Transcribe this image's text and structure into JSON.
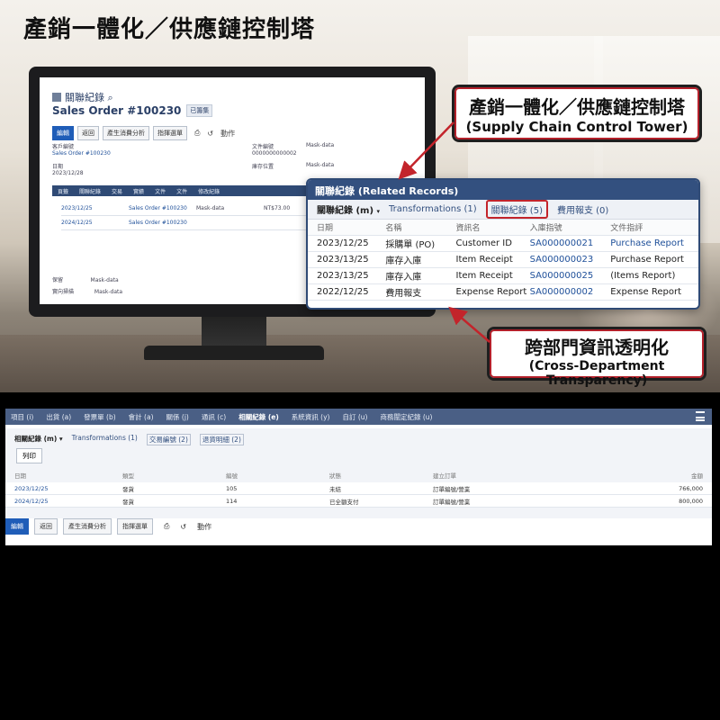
{
  "banner_title": "產銷一體化／供應鏈控制塔",
  "callout_top": {
    "zh": "產銷一體化／供應鏈控制塔",
    "en": "(Supply Chain Control Tower)"
  },
  "callout_bottom": {
    "zh": "跨部門資訊透明化",
    "en": "(Cross-Department Transparency)"
  },
  "monitor_screen": {
    "header": "關聯紀錄",
    "title": "Sales Order #100230",
    "status_badge": "已籌集",
    "toolbar": [
      "編輯",
      "返回",
      "產生消費分析",
      "指揮選單",
      "動作"
    ],
    "fields": {
      "label1": "客戶編號",
      "value1": "Sales Order #100230",
      "label2": "日期",
      "value2": "2023/12/28",
      "label3": "文件編號",
      "value3": "0000000000002",
      "label4": "庫存位置",
      "value4": "Mask-data",
      "label5": "Mask-data"
    },
    "tabs": [
      "頁籤",
      "關聯紀錄",
      "交易",
      "實績",
      "文件",
      "文件",
      "修改紀錄"
    ],
    "rows": [
      {
        "date": "2023/12/25",
        "ref": "Sales Order #100230",
        "sub": "Mask-data",
        "amount": "NT$73.00"
      },
      {
        "date": "2024/12/25",
        "ref": "Sales Order #100230",
        "sub": "",
        "amount": ""
      }
    ],
    "footer": {
      "l1": "保留",
      "v1": "Mask-data",
      "l2": "實向掃描",
      "v2": "Mask-data"
    }
  },
  "related_panel": {
    "title": "關聯紀錄 (Related Records)",
    "tabs": [
      "關聯紀錄 (m)",
      "Transformations (1)",
      "關聯紀錄 (5)",
      "費用報支 (0)"
    ],
    "columns": [
      "日期",
      "名稱",
      "資訊名",
      "入庫指號",
      "文件指評"
    ],
    "rows": [
      [
        "2023/12/25",
        "採購單 (PO)",
        "Customer ID",
        "SA000000021",
        "Purchase Report"
      ],
      [
        "2023/13/25",
        "庫存入庫",
        "Item Receipt",
        "SA000000023",
        "Purchase Report"
      ],
      [
        "2023/13/25",
        "庫存入庫",
        "Item Receipt",
        "SA000000025",
        "(Items Report)"
      ],
      [
        "2022/12/25",
        "費用報支",
        "Expense Report",
        "SA000000002",
        "Expense Report"
      ]
    ]
  },
  "app": {
    "nav": [
      "項目 (i)",
      "出貨 (a)",
      "發票單 (b)",
      "會計 (a)",
      "關係 (j)",
      "通訊 (c)",
      "相關紀錄 (e)",
      "系統資訊 (y)",
      "自訂 (u)",
      "商務闡定紀錄 (u)"
    ],
    "tabs": [
      "相關紀錄 (m)",
      "Transformations (1)",
      "交易編號 (2)",
      "退貨明細 (2)"
    ],
    "print_label": "列印",
    "columns": [
      "日期",
      "類型",
      "編號",
      "狀態",
      "建立訂單",
      "金額"
    ],
    "rows": [
      [
        "2023/12/25",
        "發貨",
        "105",
        "未結",
        "訂單編號/營業",
        "766,000"
      ],
      [
        "2024/12/25",
        "發貨",
        "114",
        "已全額支付",
        "訂單編號/營業",
        "800,000"
      ]
    ],
    "actions": [
      "編輯",
      "返回",
      "產生消費分析",
      "指揮選單",
      "動作"
    ]
  },
  "colors": {
    "nav": "#4a5f85",
    "accent": "#1f5db8",
    "highlight": "#c3242b"
  }
}
